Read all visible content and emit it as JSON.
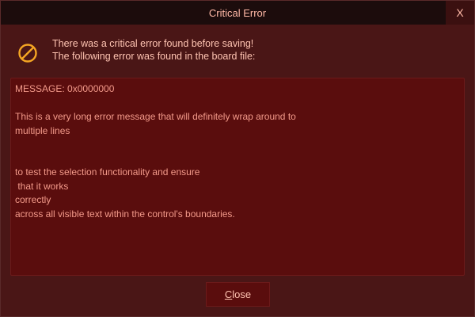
{
  "window": {
    "title": "Critical Error",
    "close_glyph": "X"
  },
  "header": {
    "icon": "prohibited-icon",
    "line1": "There was a critical error found before saving!",
    "line2": "The following error was found in the board file:"
  },
  "error_text": "MESSAGE: 0x0000000\n\nThis is a very long error message that will definitely wrap around to\nmultiple lines\n\n\nto test the selection functionality and ensure\n that it works\ncorrectly\nacross all visible text within the control's boundaries.",
  "footer": {
    "close_button": {
      "underlined": "C",
      "rest": "lose"
    }
  },
  "colors": {
    "titlebar": "#1c0c0c",
    "window": "#4a1616",
    "textarea": "#5a0d0d",
    "icon": "#f5a623"
  }
}
